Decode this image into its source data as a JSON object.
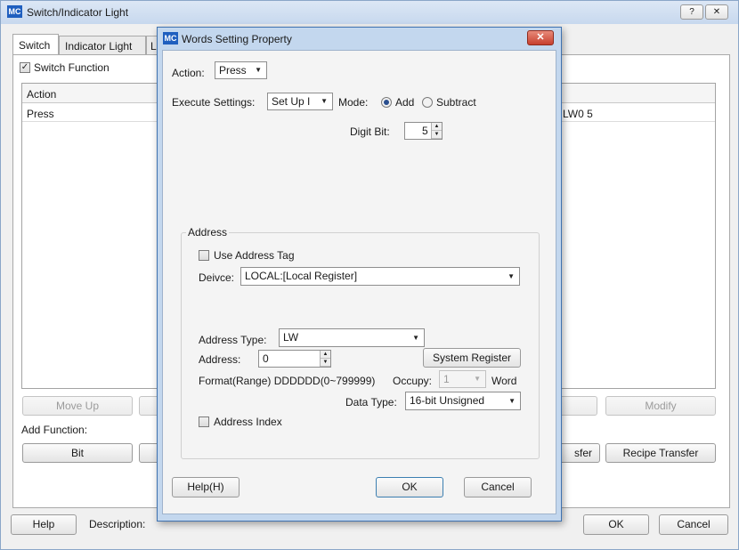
{
  "main_window": {
    "title": "Switch/Indicator Light",
    "icon_text": "MC",
    "title_buttons": [
      "?",
      "✕"
    ],
    "tabs": [
      "Switch",
      "Indicator Light",
      "L"
    ],
    "switch_function_label": "Switch Function",
    "switch_function_checked": true,
    "table": {
      "header_action": "Action",
      "row_action": "Press",
      "row_detail": "LW0 5"
    },
    "buttons": {
      "move_up": "Move Up",
      "modify": "Modify",
      "bit": "Bit",
      "transfer_partial": "sfer",
      "recipe_transfer": "Recipe Transfer",
      "help": "Help",
      "ok": "OK",
      "cancel": "Cancel"
    },
    "add_function_label": "Add Function:",
    "description_label": "Description:"
  },
  "dialog": {
    "title": "Words Setting Property",
    "icon_text": "MC",
    "close_glyph": "✕",
    "action_label": "Action:",
    "action_value": "Press",
    "execute_settings_label": "Execute Settings:",
    "execute_settings_value": "Set Up I",
    "mode_label": "Mode:",
    "mode_add": "Add",
    "mode_subtract": "Subtract",
    "mode_selected": "Add",
    "digit_bit_label": "Digit Bit:",
    "digit_bit_value": "5",
    "address_group_title": "Address",
    "use_address_tag_label": "Use Address Tag",
    "use_address_tag_checked": false,
    "device_label": "Deivce:",
    "device_value": "LOCAL:[Local Register]",
    "address_type_label": "Address Type:",
    "address_type_value": "LW",
    "address_label": "Address:",
    "address_value": "0",
    "system_register_button": "System Register",
    "format_text": "Format(Range) DDDDDD(0~799999)",
    "occupy_label": "Occupy:",
    "occupy_value": "1",
    "occupy_unit": "Word",
    "data_type_label": "Data Type:",
    "data_type_value": "16-bit Unsigned",
    "address_index_label": "Address Index",
    "address_index_checked": false,
    "help_button": "Help(H)",
    "ok_button": "OK",
    "cancel_button": "Cancel"
  },
  "colors": {
    "title_bar": "#c9daf0",
    "dialog_border": "#3f72b0",
    "close_button": "#d9534f",
    "icon_badge": "#1f5fbf"
  }
}
